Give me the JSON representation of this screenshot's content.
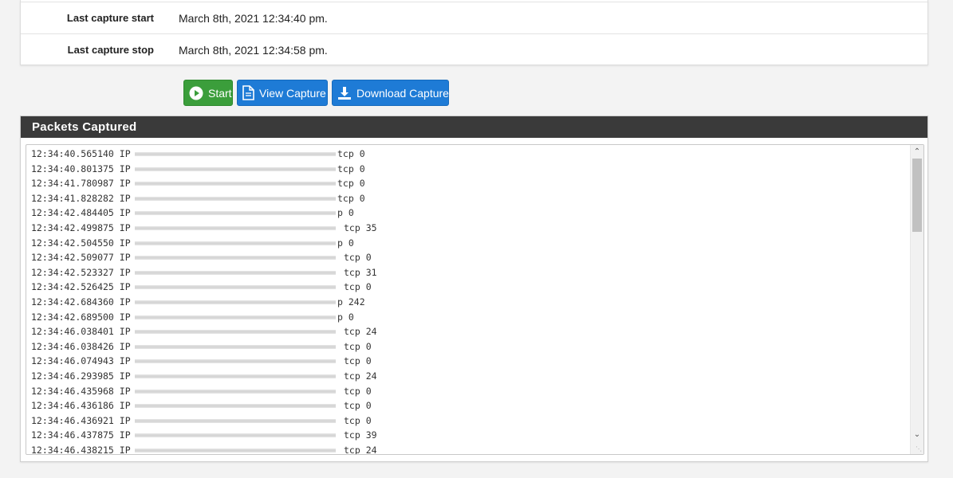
{
  "status": {
    "rows": [
      {
        "label": "Last capture start",
        "value": "March 8th, 2021 12:34:40 pm."
      },
      {
        "label": "Last capture stop",
        "value": "March 8th, 2021 12:34:58 pm."
      }
    ]
  },
  "buttons": {
    "start": {
      "label": "Start",
      "icon": "play-circle-icon",
      "color": "#3b9e3b"
    },
    "view": {
      "label": "View Capture",
      "icon": "file-icon",
      "color": "#1e7bd6"
    },
    "download": {
      "label": "Download Capture",
      "icon": "download-icon",
      "color": "#1e7bd6"
    }
  },
  "packets": {
    "heading": "Packets Captured",
    "lines": [
      {
        "time": "12:34:40.565140 IP",
        "proto": "tcp 0"
      },
      {
        "time": "12:34:40.801375 IP",
        "proto": "tcp 0"
      },
      {
        "time": "12:34:41.780987 IP",
        "proto": "tcp 0"
      },
      {
        "time": "12:34:41.828282 IP",
        "proto": "tcp 0"
      },
      {
        "time": "12:34:42.484405 IP",
        "proto": "p 0"
      },
      {
        "time": "12:34:42.499875 IP",
        "proto": "tcp 35"
      },
      {
        "time": "12:34:42.504550 IP",
        "proto": "p 0"
      },
      {
        "time": "12:34:42.509077 IP",
        "proto": "tcp 0"
      },
      {
        "time": "12:34:42.523327 IP",
        "proto": "tcp 31"
      },
      {
        "time": "12:34:42.526425 IP",
        "proto": "tcp 0"
      },
      {
        "time": "12:34:42.684360 IP",
        "proto": "p 242"
      },
      {
        "time": "12:34:42.689500 IP",
        "proto": "p 0"
      },
      {
        "time": "12:34:46.038401 IP",
        "proto": "tcp 24"
      },
      {
        "time": "12:34:46.038426 IP",
        "proto": "tcp 0"
      },
      {
        "time": "12:34:46.074943 IP",
        "proto": "tcp 0"
      },
      {
        "time": "12:34:46.293985 IP",
        "proto": "tcp 24"
      },
      {
        "time": "12:34:46.435968 IP",
        "proto": "tcp 0"
      },
      {
        "time": "12:34:46.436186 IP",
        "proto": "tcp 0"
      },
      {
        "time": "12:34:46.436921 IP",
        "proto": "tcp 0"
      },
      {
        "time": "12:34:46.437875 IP",
        "proto": "tcp 39"
      },
      {
        "time": "12:34:46.438215 IP",
        "proto": "tcp 24"
      }
    ]
  }
}
